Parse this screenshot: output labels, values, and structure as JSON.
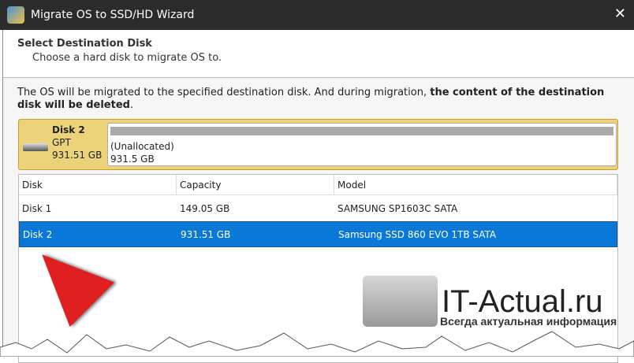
{
  "window": {
    "title": "Migrate OS to SSD/HD Wizard",
    "close": "✕"
  },
  "header": {
    "title": "Select Destination Disk",
    "subtitle": "Choose a hard disk to migrate OS to."
  },
  "message": {
    "text": "The OS will be migrated to the specified destination disk. And during migration, ",
    "bold": "the content of the destination disk will be deleted",
    "end": "."
  },
  "selected_disk": {
    "name": "Disk 2",
    "type": "GPT",
    "size": "931.51 GB",
    "partition_label": "(Unallocated)",
    "partition_size": "931.5 GB"
  },
  "table": {
    "headers": [
      "Disk",
      "Capacity",
      "Model"
    ],
    "rows": [
      {
        "disk": "Disk 1",
        "capacity": "149.05 GB",
        "model": "SAMSUNG SP1603C SATA"
      },
      {
        "disk": "Disk 2",
        "capacity": "931.51 GB",
        "model": "Samsung SSD 860 EVO 1TB SATA"
      }
    ]
  },
  "watermark": {
    "title": "IT-Actual.ru",
    "subtitle": "Всегда актуальная информация"
  }
}
